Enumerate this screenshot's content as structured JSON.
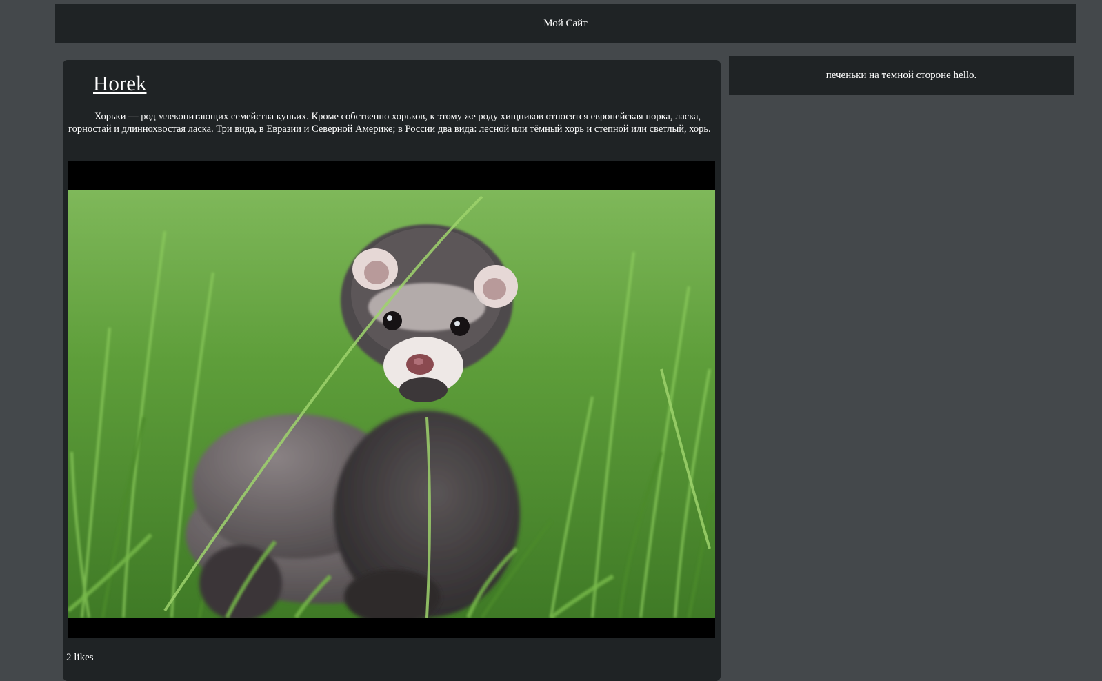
{
  "header": {
    "site_title": "Мой Сайт"
  },
  "post": {
    "title": "Horek",
    "text": "Хорьки — род млекопитающих семейства куньих. Кроме собственно хорьков, к этому же роду хищников относятся европейская норка, ласка, горностай и длиннохвостая ласка. Три вида, в Евразии и Северной Америке; в России два вида: лесной или тёмный хорь и степной или светлый, хорь.",
    "likes": "2 likes"
  },
  "sidebar": {
    "text": "печеньки на темной стороне hello."
  },
  "colors": {
    "page_background": "#44484b",
    "panel_background": "#1f2325",
    "text": "#ffffff"
  }
}
